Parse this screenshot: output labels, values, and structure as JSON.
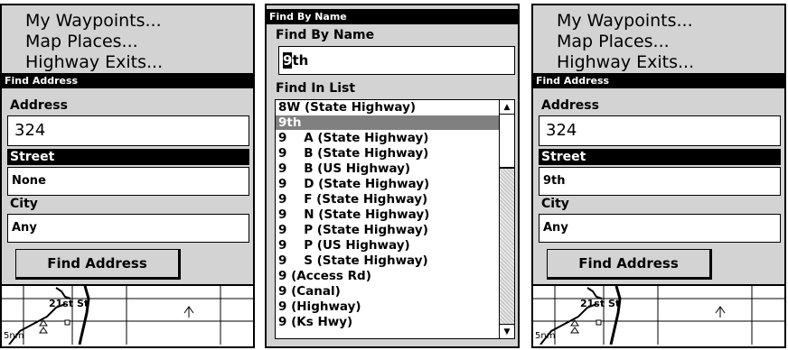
{
  "left": {
    "menu": [
      "My Waypoints...",
      "Map Places...",
      "Highway Exits..."
    ],
    "title": "Find Address",
    "address_label": "Address",
    "address_value": "324",
    "street_label": "Street",
    "street_value": "None",
    "city_label": "City",
    "city_value": "Any",
    "button": "Find Address",
    "map_label": "21st St",
    "scale": "5nm"
  },
  "middle": {
    "title": "Find By Name",
    "name_label": "Find By Name",
    "name_cursor": "9",
    "name_rest": "th",
    "list_label": "Find In List",
    "items": [
      "8W (State Highway)",
      "9th",
      "9    A (State Highway)",
      "9    B (State Highway)",
      "9    B (US Highway)",
      "9    D (State Highway)",
      "9    F (State Highway)",
      "9    N (State Highway)",
      "9    P (State Highway)",
      "9    P (US Highway)",
      "9    S (State Highway)",
      "9 (Access Rd)",
      "9 (Canal)",
      "9 (Highway)",
      "9 (Ks Hwy)"
    ],
    "selected_index": 1
  },
  "right": {
    "menu": [
      "My Waypoints...",
      "Map Places...",
      "Highway Exits..."
    ],
    "title": "Find Address",
    "address_label": "Address",
    "address_value": "324",
    "street_label": "Street",
    "street_value": "9th",
    "city_label": "City",
    "city_value": "Any",
    "button": "Find Address",
    "map_label": "21st St",
    "scale": "5nm"
  }
}
